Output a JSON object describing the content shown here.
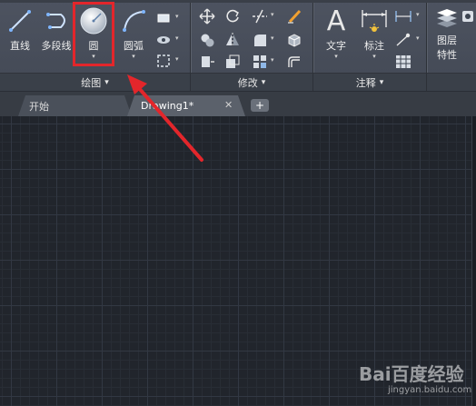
{
  "ribbon": {
    "draw_panel": {
      "line_label": "直线",
      "polyline_label": "多段线",
      "circle_label": "圆",
      "arc_label": "圆弧",
      "title": "绘图"
    },
    "modify_panel": {
      "title": "修改"
    },
    "annotation_panel": {
      "text_label": "文字",
      "dimension_label": "标注",
      "title": "注释"
    },
    "layers_panel": {
      "label_line1": "图层",
      "label_line2": "特性"
    }
  },
  "tabs": {
    "start_label": "开始",
    "drawing_label": "Drawing1*",
    "close_glyph": "✕",
    "add_glyph": "+"
  },
  "icons": {
    "text_glyph": "A",
    "dropdown_glyph": "▾"
  },
  "watermark": {
    "brand": "Bai百度经验",
    "url": "jingyan.baidu.com"
  },
  "colors": {
    "highlight": "#e3262b",
    "canvas": "#21252c",
    "ribbon": "#474d58"
  }
}
